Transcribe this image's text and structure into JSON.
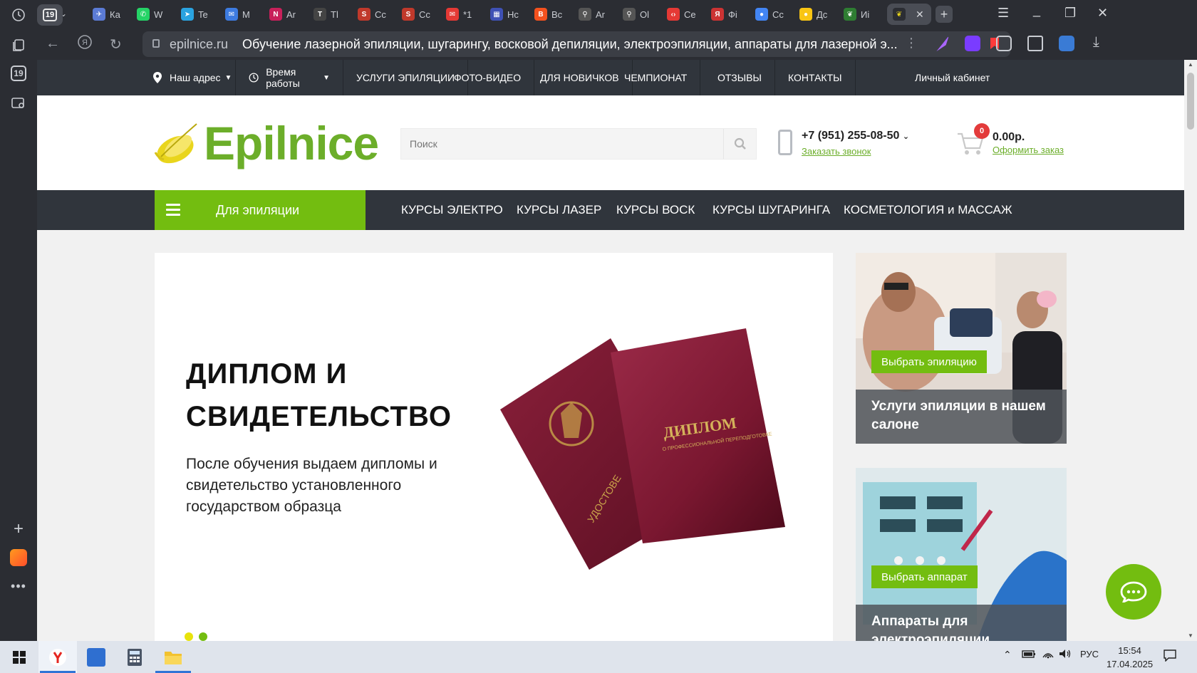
{
  "browser": {
    "tab_counter": "19",
    "tabs": [
      {
        "label": "Ка",
        "color": "#5b7bd5",
        "glyph": "✈"
      },
      {
        "label": "W",
        "color": "#25d366",
        "glyph": "✆"
      },
      {
        "label": "Te",
        "color": "#2aa3e0",
        "glyph": "➤"
      },
      {
        "label": "М",
        "color": "#3d7be0",
        "glyph": "✉"
      },
      {
        "label": "Ar",
        "color": "#c8205a",
        "glyph": "N"
      },
      {
        "label": "Tl",
        "color": "#444444",
        "glyph": "T"
      },
      {
        "label": "Сс",
        "color": "#c0392b",
        "glyph": "S"
      },
      {
        "label": "Сс",
        "color": "#c0392b",
        "glyph": "S"
      },
      {
        "label": "*1",
        "color": "#e53935",
        "glyph": "✉"
      },
      {
        "label": "Нс",
        "color": "#3f51b5",
        "glyph": "▦"
      },
      {
        "label": "Вс",
        "color": "#f4511e",
        "glyph": "B"
      },
      {
        "label": "Ar",
        "color": "#555555",
        "glyph": "⚲"
      },
      {
        "label": "Ol",
        "color": "#555555",
        "glyph": "⚲"
      },
      {
        "label": "Се",
        "color": "#e53935",
        "glyph": "‹›"
      },
      {
        "label": "Фі",
        "color": "#cc3333",
        "glyph": "Я"
      },
      {
        "label": "Сс",
        "color": "#4285f4",
        "glyph": "●"
      },
      {
        "label": "Дс",
        "color": "#f9c513",
        "glyph": "●"
      },
      {
        "label": "Иі",
        "color": "#2e7d32",
        "glyph": "❦"
      }
    ],
    "url_domain": "epilnice.ru",
    "url_title": "Обучение лазерной эпиляции, шугарингу, восковой депиляции, электроэпиляции, аппараты для лазерной э..."
  },
  "topnav": {
    "address": "Наш адрес",
    "hours": "Время работы",
    "items": [
      "УСЛУГИ ЭПИЛЯЦИИ",
      "ФОТО-ВИДЕО",
      "ДЛЯ НОВИЧКОВ",
      "ЧЕМПИОНАТ",
      "ОТЗЫВЫ",
      "КОНТАКТЫ"
    ],
    "account": "Личный кабинет"
  },
  "header": {
    "logo": "Epilnice",
    "search_placeholder": "Поиск",
    "phone": "+7 (951) 255-08-50",
    "callback": "Заказать звонок",
    "cart_count": "0",
    "cart_sum": "0.00р.",
    "checkout": "Оформить заказ"
  },
  "catnav": {
    "catalog": "Для эпиляции",
    "links": [
      "КУРСЫ ЭЛЕКТРО",
      "КУРСЫ ЛАЗЕР",
      "КУРСЫ ВОСК",
      "КУРСЫ ШУГАРИНГА",
      "КОСМЕТОЛОГИЯ и МАССАЖ"
    ]
  },
  "slide": {
    "title": "ДИПЛОМ И СВИДЕТЕЛЬСТВО",
    "text": "После обучения выдаем дипломы и свидетельство установленного государством образца",
    "diploma_label": "ДИПЛОМ",
    "diploma_sub": "О ПРОФЕССИОНАЛЬНОЙ ПЕРЕПОДГОТОВКЕ",
    "certificate_label": "УДОСТОВЕ"
  },
  "promos": [
    {
      "button": "Выбрать эпиляцию",
      "caption": "Услуги эпиляции в нашем салоне"
    },
    {
      "button": "Выбрать аппарат",
      "caption": "Аппараты для электроэпиляции"
    }
  ],
  "taskbar": {
    "lang": "РУС",
    "time": "15:54",
    "date": "17.04.2025"
  },
  "colors": {
    "accent": "#73bd10",
    "brand_green": "#6cae2a",
    "dark_nav": "#30353c"
  }
}
